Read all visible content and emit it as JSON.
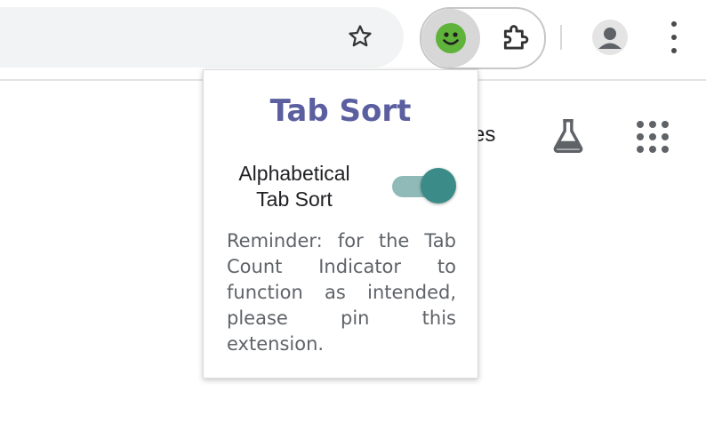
{
  "toolbar": {
    "star_icon": "bookmark-star-icon",
    "active_extension_icon": "tab-sort-smiley-icon",
    "extensions_icon": "puzzle-piece-icon",
    "profile_icon": "profile-avatar-icon",
    "menu_icon": "kebab-menu-icon"
  },
  "page": {
    "link_fragment": "es",
    "labs_icon": "flask-icon",
    "apps_icon": "apps-grid-icon"
  },
  "popup": {
    "title": "Tab Sort",
    "toggle_label": "Alphabetical Tab Sort",
    "toggle_on": true,
    "reminder": "Reminder: for the Tab Count Indicator to function as intended, please pin this extension."
  },
  "colors": {
    "title": "#5b5fa0",
    "toggle_track": "#8fbab7",
    "toggle_knob": "#3b8c88",
    "smiley": "#5fb33a"
  }
}
